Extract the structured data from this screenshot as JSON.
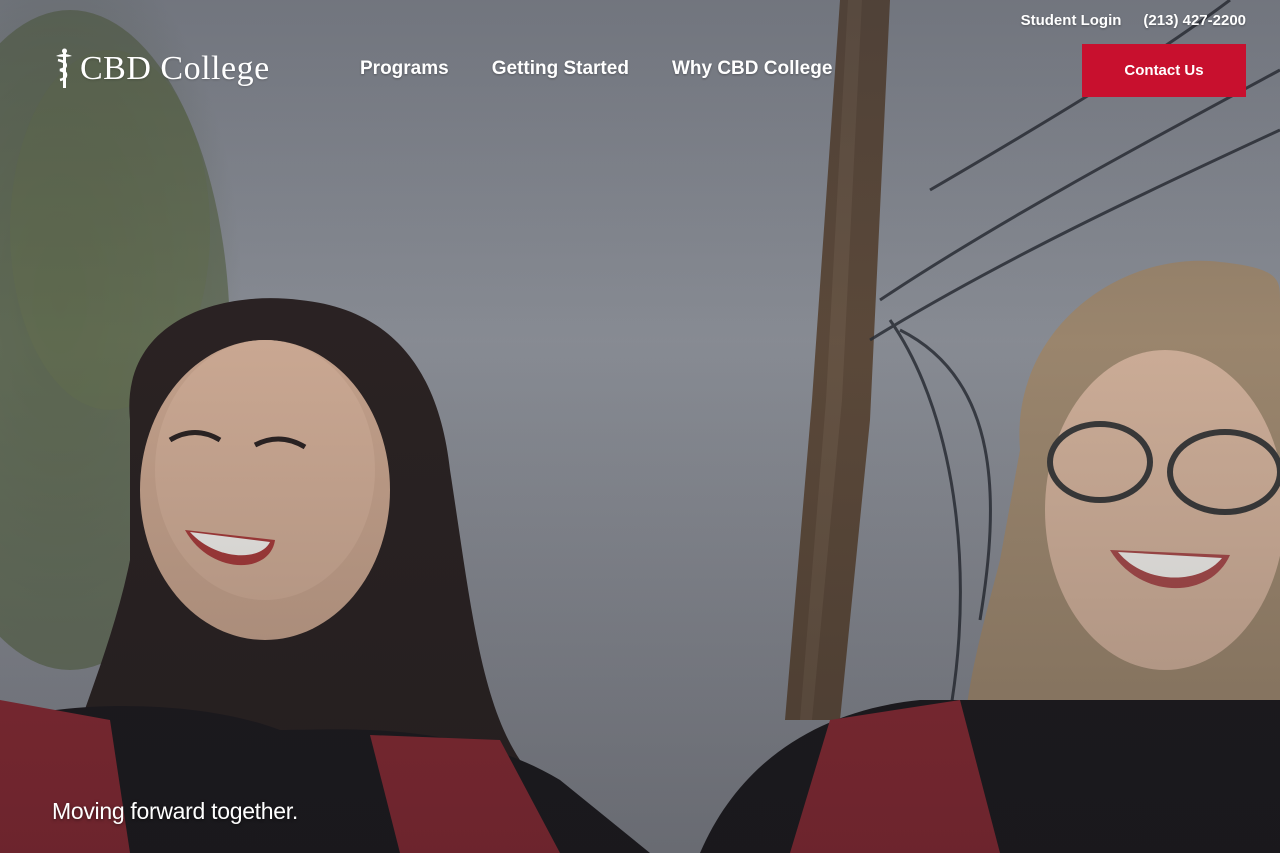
{
  "header": {
    "utility_links": [
      {
        "label": "Student Login"
      },
      {
        "label": "(213) 427-2200"
      }
    ],
    "logo": {
      "text": "CBD College",
      "icon": "caduceus-icon"
    },
    "nav": [
      {
        "label": "Programs"
      },
      {
        "label": "Getting Started"
      },
      {
        "label": "Why CBD College"
      }
    ],
    "cta_label": "Contact Us"
  },
  "hero": {
    "tagline": "Moving forward together.",
    "image": "two smiling graduates in black gowns with red stoles"
  },
  "colors": {
    "accent": "#c8102e",
    "text": "#ffffff"
  }
}
